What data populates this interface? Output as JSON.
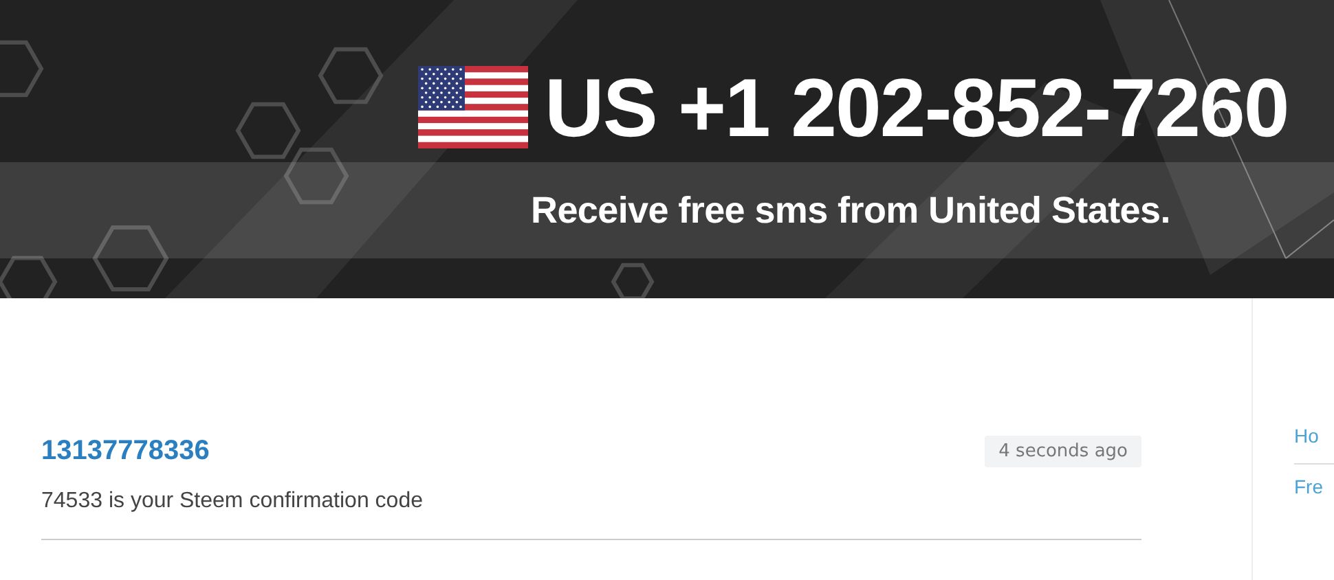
{
  "header": {
    "country_code": "US",
    "phone_number": "+1 202-852-7260",
    "subtitle": "Receive free sms from United States."
  },
  "messages": [
    {
      "sender": "13137778336",
      "time": "4 seconds ago",
      "text": "74533 is your Steem confirmation code"
    }
  ],
  "sidebar": {
    "links": [
      "Ho",
      "Fre"
    ]
  }
}
